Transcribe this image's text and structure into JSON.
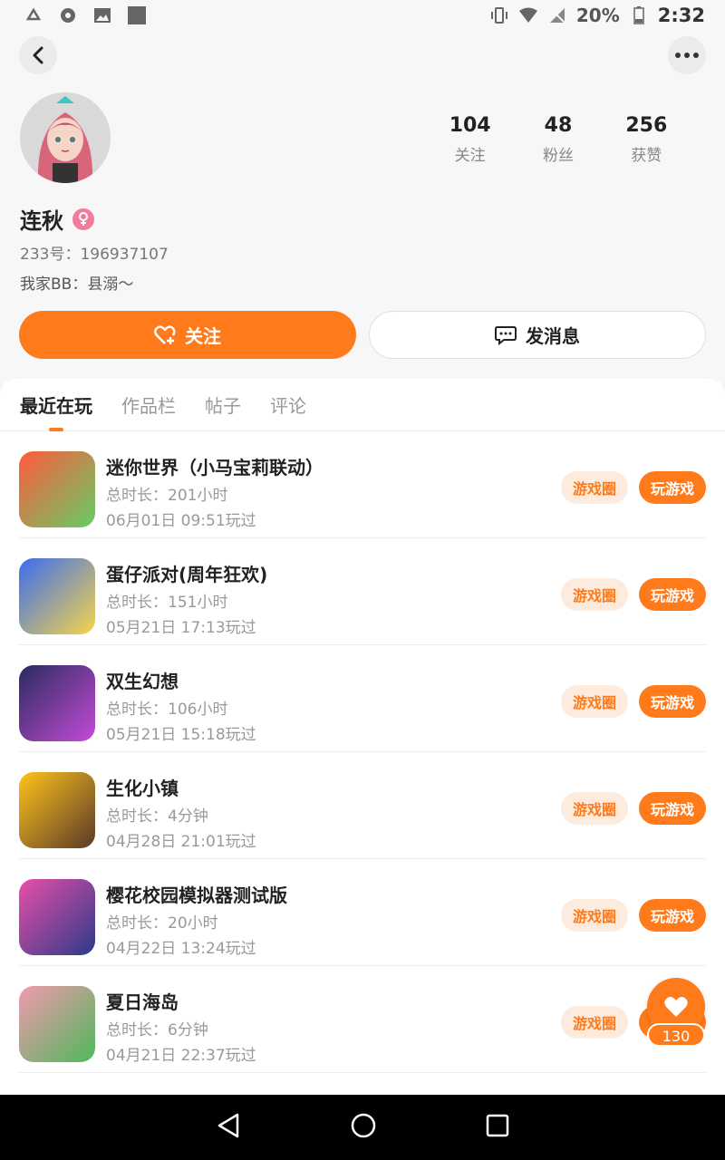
{
  "status_bar": {
    "left_icons": [
      "notification-icon",
      "sync-icon",
      "image-icon",
      "app-icon"
    ],
    "battery": "20%",
    "time": "2:32"
  },
  "profile": {
    "name": "连秋",
    "gender": "female",
    "uid": "233号：196937107",
    "bio": "我家BB：县溺～",
    "stats": [
      {
        "value": "104",
        "label": "关注"
      },
      {
        "value": "48",
        "label": "粉丝"
      },
      {
        "value": "256",
        "label": "获赞"
      }
    ]
  },
  "actions": {
    "follow_label": "关注",
    "message_label": "发消息"
  },
  "tabs": [
    {
      "label": "最近在玩",
      "active": true
    },
    {
      "label": "作品栏",
      "active": false
    },
    {
      "label": "帖子",
      "active": false
    },
    {
      "label": "评论",
      "active": false
    }
  ],
  "games": [
    {
      "title": "迷你世界（小马宝莉联动）",
      "duration": "总时长：201小时",
      "last_played": "06月01日 09:51玩过",
      "circle_label": "游戏圈",
      "play_label": "玩游戏",
      "icon_colors": [
        "#ff5a3c",
        "#66cc66"
      ]
    },
    {
      "title": "蛋仔派对(周年狂欢)",
      "duration": "总时长：151小时",
      "last_played": "05月21日 17:13玩过",
      "circle_label": "游戏圈",
      "play_label": "玩游戏",
      "icon_colors": [
        "#3a6cf0",
        "#f6d54a"
      ]
    },
    {
      "title": "双生幻想",
      "duration": "总时长：106小时",
      "last_played": "05月21日 15:18玩过",
      "circle_label": "游戏圈",
      "play_label": "玩游戏",
      "icon_colors": [
        "#2a2b5e",
        "#c44bd8"
      ]
    },
    {
      "title": "生化小镇",
      "duration": "总时长：4分钟",
      "last_played": "04月28日 21:01玩过",
      "circle_label": "游戏圈",
      "play_label": "玩游戏",
      "icon_colors": [
        "#ffc21a",
        "#5a3a2a"
      ]
    },
    {
      "title": "樱花校园模拟器测试版",
      "duration": "总时长：20小时",
      "last_played": "04月22日 13:24玩过",
      "circle_label": "游戏圈",
      "play_label": "玩游戏",
      "icon_colors": [
        "#e84fa8",
        "#2b3a8a"
      ]
    },
    {
      "title": "夏日海岛",
      "duration": "总时长：6分钟",
      "last_played": "04月21日 22:37玩过",
      "circle_label": "游戏圈",
      "play_label": "玩游戏",
      "icon_colors": [
        "#f29ab0",
        "#4fb85a"
      ]
    }
  ],
  "fab": {
    "count": "130"
  },
  "colors": {
    "accent": "#ff7a1a",
    "accent_light": "#fdebdd"
  }
}
